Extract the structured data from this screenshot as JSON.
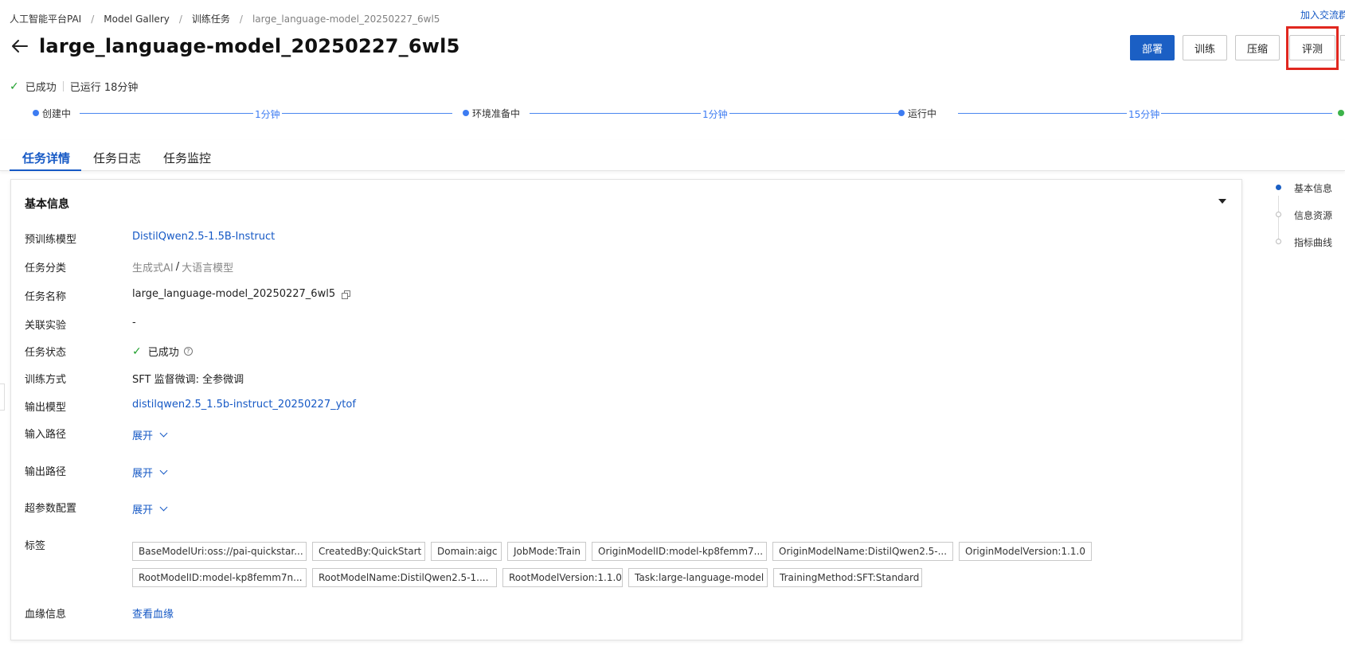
{
  "breadcrumb": {
    "items": [
      "人工智能平台PAI",
      "Model Gallery",
      "训练任务",
      "large_language-model_20250227_6wl5"
    ],
    "sep": "/"
  },
  "top_link": "加入交流群",
  "header": {
    "title": "large_language-model_20250227_6wl5",
    "buttons": {
      "deploy": "部署",
      "train": "训练",
      "compress": "压缩",
      "evaluate": "评测"
    }
  },
  "status": {
    "state": "已成功",
    "runtime": "已运行 18分钟"
  },
  "timeline": {
    "steps": [
      "创建中",
      "环境准备中",
      "运行中"
    ],
    "durations": [
      "1分钟",
      "1分钟",
      "15分钟"
    ]
  },
  "tabs": [
    "任务详情",
    "任务日志",
    "任务监控"
  ],
  "basic_info": {
    "title": "基本信息",
    "labels": {
      "pretrained": "预训练模型",
      "category": "任务分类",
      "name": "任务名称",
      "experiment": "关联实验",
      "status": "任务状态",
      "method": "训练方式",
      "output_model": "输出模型",
      "input_path": "输入路径",
      "output_path": "输出路径",
      "hyperparams": "超参数配置",
      "tags": "标签",
      "lineage": "血缘信息"
    },
    "values": {
      "pretrained": "DistilQwen2.5-1.5B-Instruct",
      "category_main": "生成式AI",
      "category_sep": "/",
      "category_sub": "大语言模型",
      "name": "large_language-model_20250227_6wl5",
      "experiment": "-",
      "status": "已成功",
      "method": "SFT 监督微调: 全参微调",
      "output_model": "distilqwen2.5_1.5b-instruct_20250227_ytof",
      "expand": "展开",
      "lineage": "查看血缘"
    },
    "tags_row1": [
      "BaseModelUri:oss://pai-quickstar...",
      "CreatedBy:QuickStart",
      "Domain:aigc",
      "JobMode:Train",
      "OriginModelID:model-kp8femm7...",
      "OriginModelName:DistilQwen2.5-...",
      "OriginModelVersion:1.1.0"
    ],
    "tags_row2": [
      "RootModelID:model-kp8femm7n...",
      "RootModelName:DistilQwen2.5-1....",
      "RootModelVersion:1.1.0",
      "Task:large-language-model",
      "TrainingMethod:SFT:Standard"
    ]
  },
  "toc": [
    "基本信息",
    "信息资源",
    "指标曲线"
  ]
}
